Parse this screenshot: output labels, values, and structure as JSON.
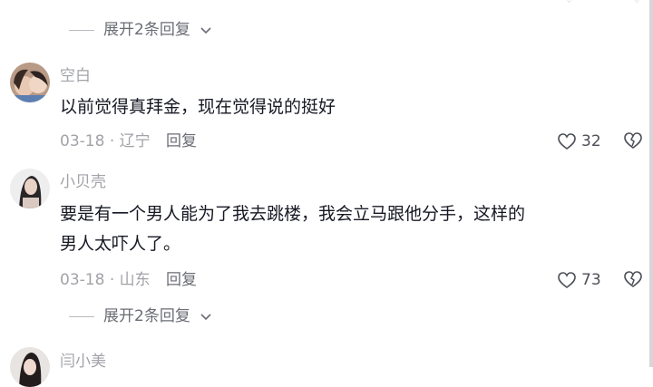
{
  "top_partial": {
    "expand_label": "展开2条回复"
  },
  "comments": [
    {
      "username": "空白",
      "text": "以前觉得真拜金，现在觉得说的挺好",
      "date": "03-18",
      "location": "辽宁",
      "reply_label": "回复",
      "likes": "32"
    },
    {
      "username": "小贝壳",
      "text_line1": "要是有一个男人能为了我去跳楼，我会立马跟他分手，这样的",
      "text_line2": "男人太吓人了。",
      "date": "03-18",
      "location": "山东",
      "reply_label": "回复",
      "likes": "73",
      "expand_label": "展开2条回复"
    },
    {
      "username": "闫小美"
    }
  ],
  "separator": "·",
  "icons": {
    "like": "heart-outline-icon",
    "dislike": "broken-heart-icon",
    "expand": "chevron-down-icon"
  },
  "colors": {
    "meta": "#a2a3a8",
    "text": "#161823",
    "link": "#6b6d75"
  }
}
